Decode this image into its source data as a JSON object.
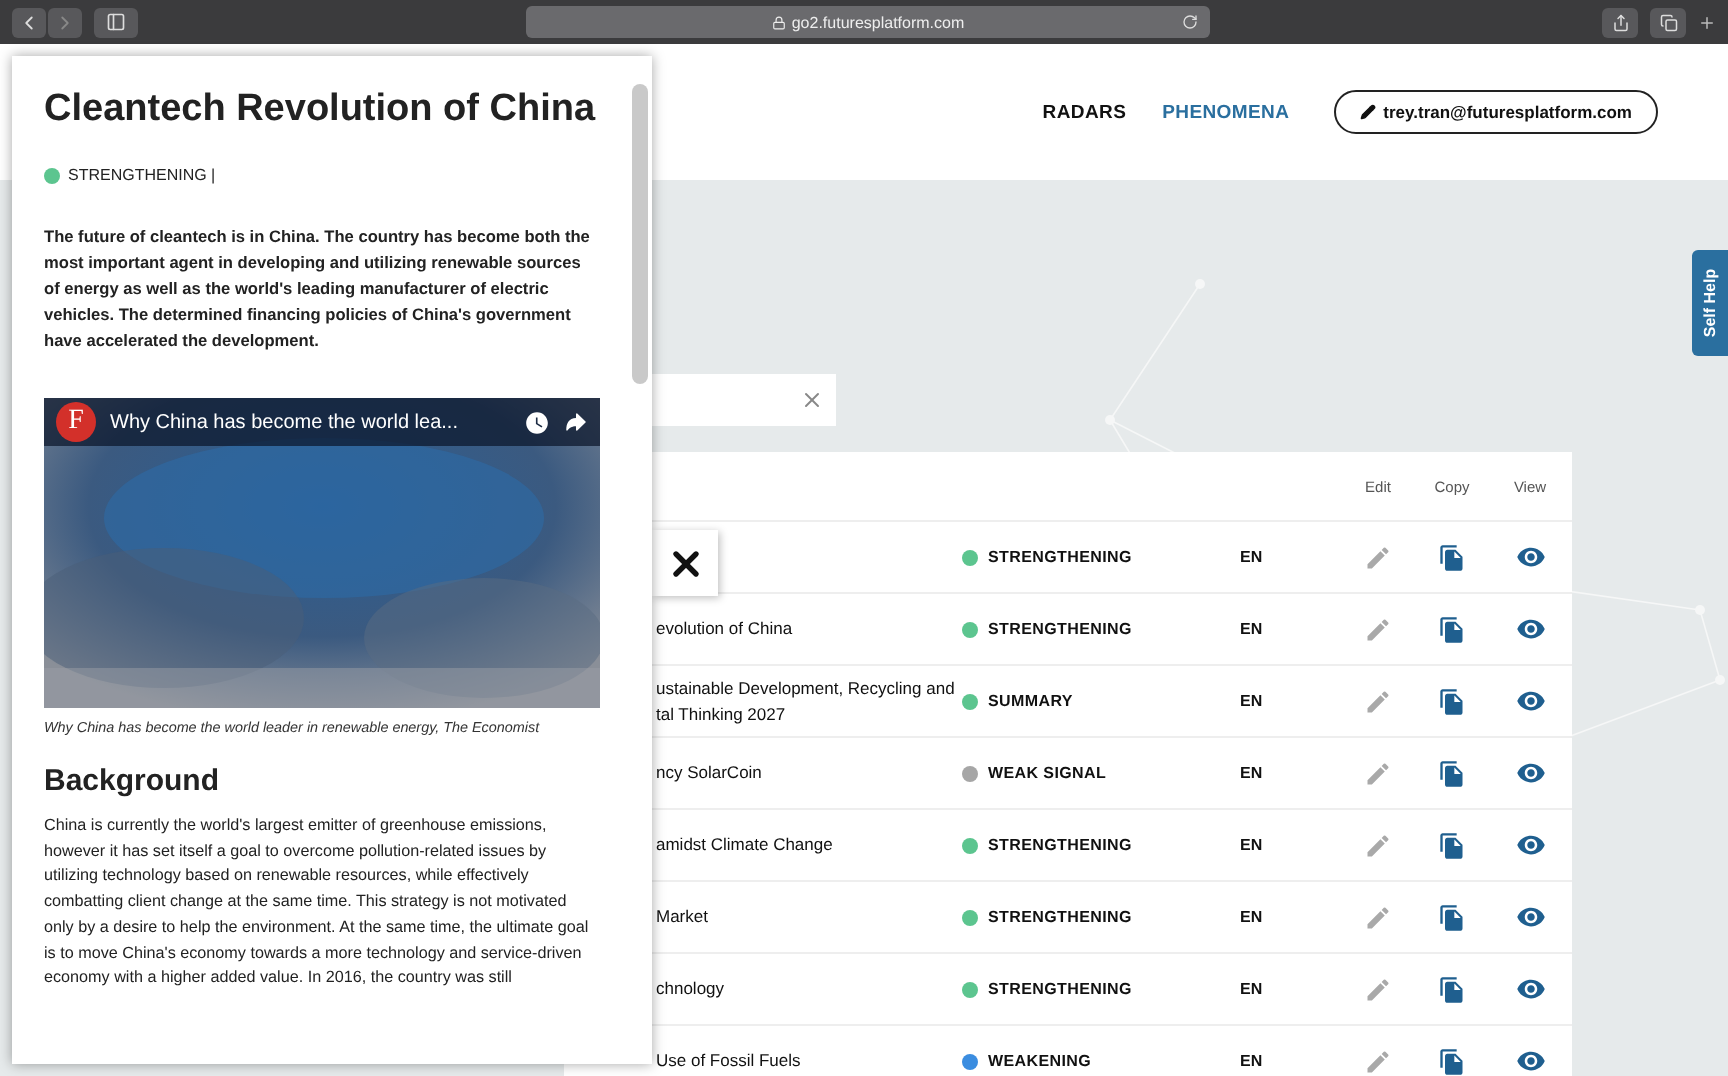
{
  "browser": {
    "url": "go2.futuresplatform.com"
  },
  "header": {
    "nav": [
      {
        "label": "RADARS",
        "selected": false
      },
      {
        "label": "PHENOMENA",
        "selected": true
      }
    ],
    "user_button": "trey.tran@futuresplatform.com"
  },
  "self_help": "Self Help",
  "table": {
    "columns": [
      "Edit",
      "Copy",
      "View"
    ],
    "rows": [
      {
        "title": "",
        "status": "STRENGTHENING",
        "color": "#5cc58f",
        "language": "EN"
      },
      {
        "title": "evolution of China",
        "status": "STRENGTHENING",
        "color": "#5cc58f",
        "language": "EN"
      },
      {
        "title": "ustainable Development, Recycling and\ntal Thinking 2027",
        "status": "SUMMARY",
        "color": "#5cc58f",
        "language": "EN"
      },
      {
        "title": "ncy SolarCoin",
        "status": "WEAK SIGNAL",
        "color": "#a6a6a6",
        "language": "EN"
      },
      {
        "title": "amidst Climate Change",
        "status": "STRENGTHENING",
        "color": "#5cc58f",
        "language": "EN"
      },
      {
        "title": "Market",
        "status": "STRENGTHENING",
        "color": "#5cc58f",
        "language": "EN"
      },
      {
        "title": "chnology",
        "status": "STRENGTHENING",
        "color": "#5cc58f",
        "language": "EN"
      },
      {
        "title": "Use of Fossil Fuels",
        "status": "WEAKENING",
        "color": "#3b8de0",
        "language": "EN"
      }
    ]
  },
  "panel": {
    "title": "Cleantech Revolution of China",
    "status": {
      "label": "STRENGTHENING |",
      "color": "#5cc58f"
    },
    "lead": "The future of cleantech is in China. The country has become both the most important agent in developing and utilizing renewable sources of energy as well as the world's leading manufacturer of electric vehicles. The determined financing policies of China's government have accelerated the development.",
    "video": {
      "logo": "F",
      "title": "Why China has become the world lea..."
    },
    "caption": "Why China has become the world leader in renewable energy, The Economist",
    "heading": "Background",
    "body": "China is currently the world's largest emitter of greenhouse emissions, however it has set itself a goal to overcome pollution-related issues by utilizing technology based on renewable resources, while effectively combatting client change at the same time. This strategy is not motivated only by a desire to help the environment. At the same time, the ultimate goal is to move China's economy towards a more technology and service-driven economy with a higher added value. In 2016, the country was still"
  }
}
